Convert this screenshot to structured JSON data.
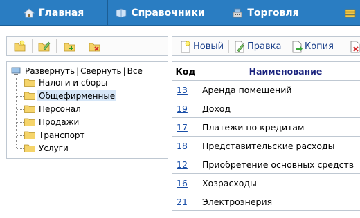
{
  "nav": [
    {
      "label": "Главная",
      "icon": "home-icon"
    },
    {
      "label": "Справочники",
      "icon": "book-icon"
    },
    {
      "label": "Торговля",
      "icon": "cash-register-icon"
    },
    {
      "label": "",
      "icon": "stack-icon"
    }
  ],
  "tree": {
    "expand": "Развернуть",
    "collapse": "Свернуть",
    "all": "Все",
    "separator": "|",
    "items": [
      {
        "label": "Налоги и сборы",
        "selected": false
      },
      {
        "label": "Общефирменные",
        "selected": true
      },
      {
        "label": "Персонал",
        "selected": false
      },
      {
        "label": "Продажи",
        "selected": false
      },
      {
        "label": "Транспорт",
        "selected": false
      },
      {
        "label": "Услуги",
        "selected": false
      }
    ]
  },
  "right_toolbar": {
    "new_label": "Новый",
    "edit_label": "Правка",
    "copy_label": "Копия"
  },
  "table": {
    "headers": {
      "code": "Код",
      "name": "Наименование"
    },
    "rows": [
      {
        "code": "13",
        "name": "Аренда помещений"
      },
      {
        "code": "19",
        "name": "Доход"
      },
      {
        "code": "17",
        "name": "Платежи по кредитам"
      },
      {
        "code": "18",
        "name": "Представительские расходы"
      },
      {
        "code": "12",
        "name": "Приобретение основных средств"
      },
      {
        "code": "16",
        "name": "Хозрасходы"
      },
      {
        "code": "21",
        "name": "Электроэнерия"
      }
    ]
  },
  "colors": {
    "nav_bg": "#2a7dc2",
    "link": "#1a4fa8",
    "header_text": "#1a237e",
    "selection": "#d6e6f7",
    "border": "#bfc8d2"
  }
}
